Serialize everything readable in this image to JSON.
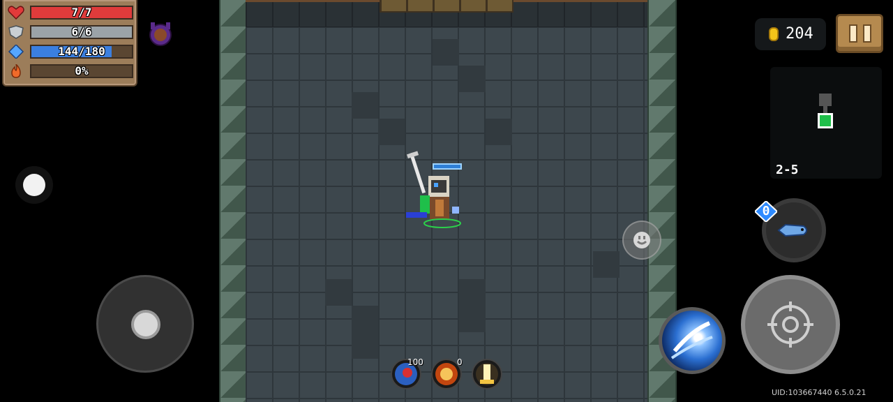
{
  "hud": {
    "health": {
      "current": 7,
      "max": 7,
      "label": "7/7",
      "color": "#e03b3b"
    },
    "armor": {
      "current": 6,
      "max": 6,
      "label": "6/6",
      "color": "#9ba3a8"
    },
    "energy": {
      "current": 144,
      "max": 180,
      "label": "144/180",
      "color": "#3b7fe0"
    },
    "skill_charge": {
      "percent": 0,
      "label": "0%",
      "color": "#e06a2a"
    },
    "buff_icon": "purple-pet-buff-icon"
  },
  "coins": {
    "value": "204",
    "icon": "gold-coin-icon"
  },
  "pause": {
    "icon": "pause-icon"
  },
  "minimap": {
    "level": "2-5"
  },
  "weapon": {
    "energy_cost": "0",
    "icon": "fish-weapon-icon"
  },
  "active_buffs": [
    {
      "name": "blue-slash-buff",
      "count": "100",
      "icon": "red-blue-buff-icon"
    },
    {
      "name": "fire-fist-buff",
      "count": "0",
      "icon": "fire-fist-icon"
    },
    {
      "name": "light-buff",
      "count": "",
      "icon": "golden-light-icon"
    }
  ],
  "footer": {
    "uid": "UID:103667440 6.5.0.21"
  }
}
